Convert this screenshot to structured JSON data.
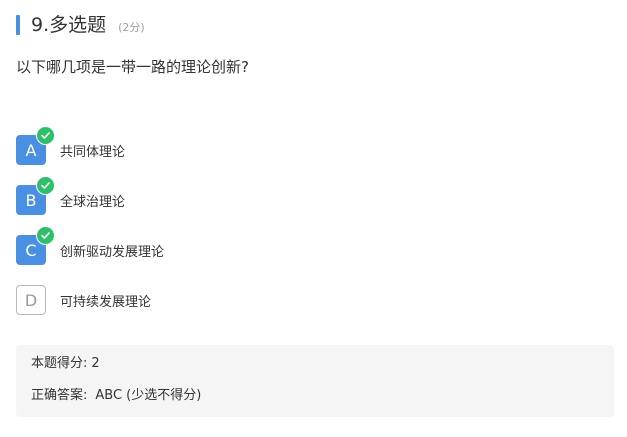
{
  "question": {
    "title": "9.多选题",
    "score_tag": "(2分)",
    "text": "以下哪几项是一带一路的理论创新?"
  },
  "options": [
    {
      "letter": "A",
      "label": "共同体理论",
      "selected": true
    },
    {
      "letter": "B",
      "label": "全球治理论",
      "selected": true
    },
    {
      "letter": "C",
      "label": "创新驱动发展理论",
      "selected": true
    },
    {
      "letter": "D",
      "label": "可持续发展理论",
      "selected": false
    }
  ],
  "summary": {
    "score_label": "本题得分:",
    "score_value": "2",
    "answer_label": "正确答案:",
    "answer_value": "ABC (少选不得分)"
  },
  "colors": {
    "accent": "#4a90e2",
    "check": "#2fbf6a",
    "summary_bg": "#f5f5f5"
  },
  "icons": {
    "correct_mark": "check-icon"
  }
}
